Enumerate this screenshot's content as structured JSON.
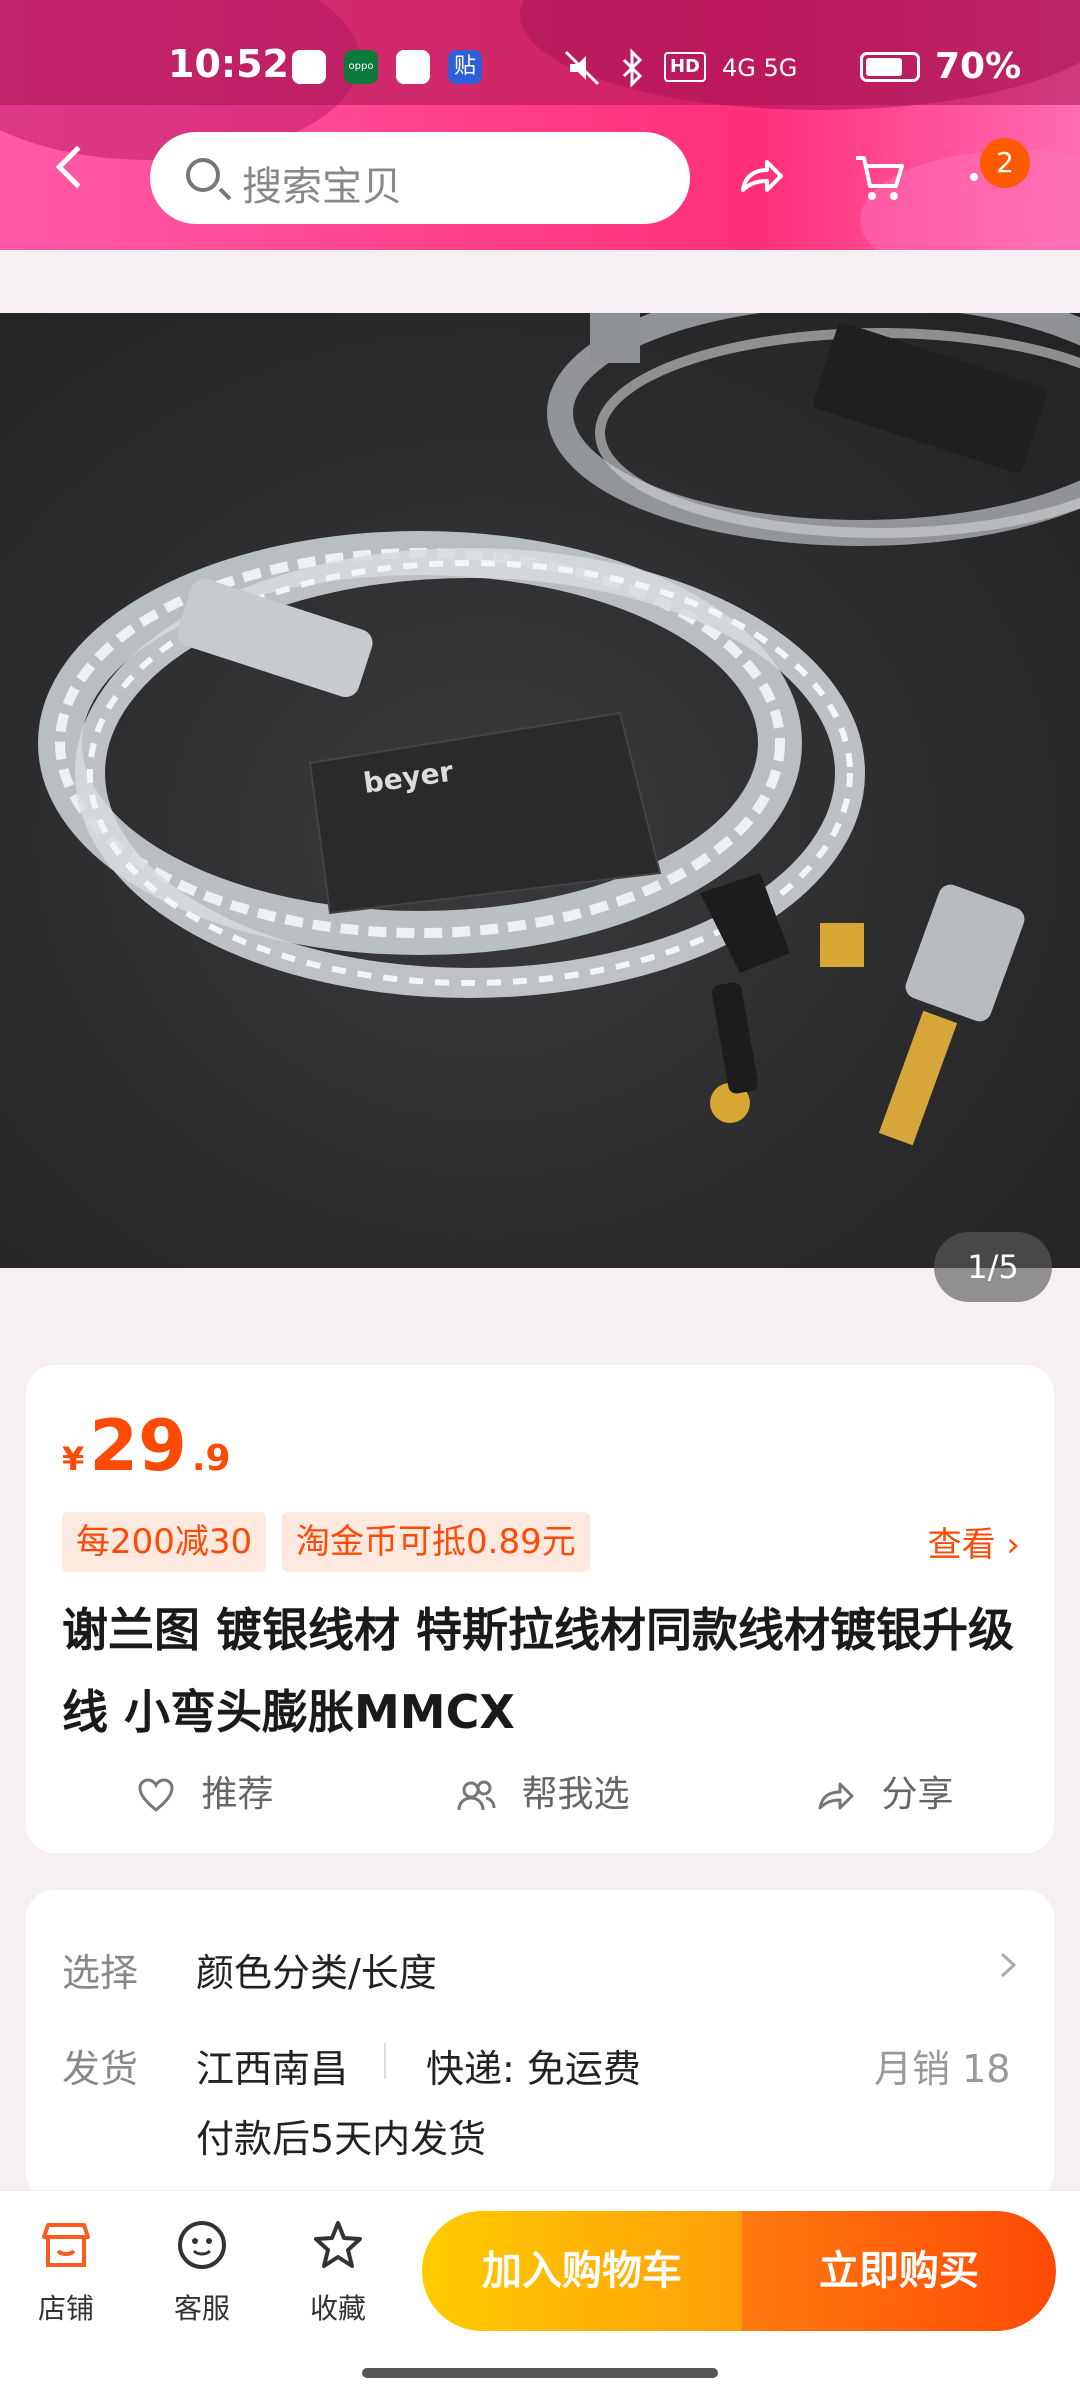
{
  "status": {
    "time": "10:52",
    "battery": "70%",
    "network": "4G 5G",
    "app_icon_oppo": "oppo",
    "app_icon_tie": "贴"
  },
  "header": {
    "search_placeholder": "搜索宝贝",
    "cart_badge": "2"
  },
  "gallery": {
    "pager": "1/5",
    "brand_text": "beyer"
  },
  "product": {
    "currency": "¥",
    "price_int": "29",
    "price_dec": ".9",
    "promo1": "每200减30",
    "promo2": "淘金币可抵0.89元",
    "view_more": "查看 ›",
    "title": "谢兰图 镀银线材 特斯拉线材同款线材镀银升级线 小弯头膨胀MMCX",
    "actions": {
      "recommend": "推荐",
      "help_choose": "帮我选",
      "share": "分享"
    }
  },
  "spec": {
    "choose_label": "选择",
    "choose_value": "颜色分类/长度",
    "ship_label": "发货",
    "ship_origin": "江西南昌",
    "ship_method": "快递: 免运费",
    "monthly_sales": "月销  18",
    "ship_time": "付款后5天内发货"
  },
  "bottom": {
    "store": "店铺",
    "service": "客服",
    "favorite": "收藏",
    "add_cart": "加入购物车",
    "buy_now": "立即购买"
  },
  "colors": {
    "accent": "#ff4a06",
    "header_pink": "#ff3f88"
  }
}
